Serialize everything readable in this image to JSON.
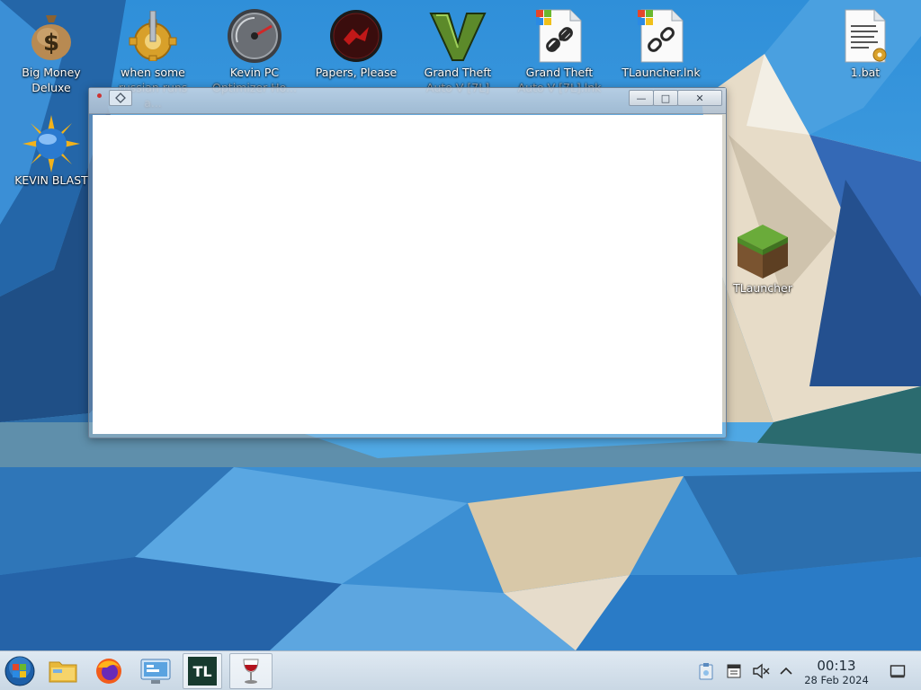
{
  "desktop": {
    "icons": [
      {
        "name": "big-money-deluxe",
        "label": "Big Money Deluxe",
        "icon": "money-bag-icon"
      },
      {
        "name": "when-some",
        "label": "when some",
        "label_faded": "russian runs a...",
        "icon": "gear-lever-icon"
      },
      {
        "name": "kevin-pc",
        "label": "Kevin PC",
        "label_faded": "Optimizer Ho...",
        "icon": "gauge-icon"
      },
      {
        "name": "papers-please",
        "label": "Papers, Please",
        "icon": "papers-please-emblem-icon"
      },
      {
        "name": "gta-v",
        "label": "Grand Theft",
        "label_faded": "Auto V [7L]",
        "icon": "gta-v-logo-icon"
      },
      {
        "name": "gta-v-lnk",
        "label": "Grand Theft",
        "label_faded": "Auto V [7L].lnk",
        "icon": "shortcut-link-icon"
      },
      {
        "name": "tlauncher-lnk",
        "label": "TLauncher.lnk",
        "icon": "shortcut-link-icon"
      },
      {
        "name": "one-bat",
        "label": "1.bat",
        "icon": "batch-file-icon"
      },
      {
        "name": "kevin-blast",
        "label": "KEVIN BLAST",
        "icon": "sun-globe-icon"
      },
      {
        "name": "tlauncher",
        "label": "TLauncher",
        "icon": "grass-block-icon"
      }
    ]
  },
  "window": {
    "title": "",
    "buttons": {
      "minimize": "—",
      "maximize": "□",
      "close": "✕"
    }
  },
  "taskbar": {
    "items": [
      {
        "name": "start",
        "icon": "windows-start-icon"
      },
      {
        "name": "file-manager",
        "icon": "folder-icon"
      },
      {
        "name": "firefox",
        "icon": "firefox-icon"
      },
      {
        "name": "control-panel",
        "icon": "control-panel-icon"
      },
      {
        "name": "tlauncher",
        "icon": "tlauncher-icon",
        "text": "TL"
      },
      {
        "name": "wine",
        "icon": "wine-glass-icon"
      }
    ],
    "tray": [
      {
        "name": "clipboard",
        "icon": "clipboard-icon"
      },
      {
        "name": "notes",
        "icon": "notes-icon"
      },
      {
        "name": "volume-muted",
        "icon": "speaker-muted-icon"
      },
      {
        "name": "show-hidden",
        "icon": "chevron-up-icon"
      }
    ],
    "clock": {
      "time": "00:13",
      "date": "28 Feb 2024"
    }
  }
}
